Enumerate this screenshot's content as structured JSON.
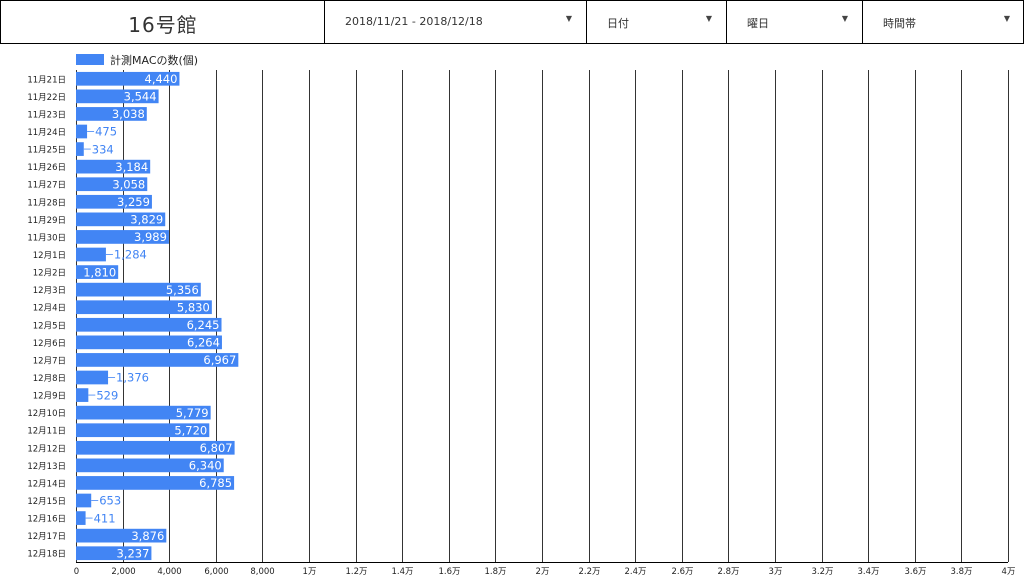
{
  "header": {
    "title": "16号館",
    "filters": [
      {
        "label": "2018/11/21 - 2018/12/18"
      },
      {
        "label": "日付"
      },
      {
        "label": "曜日"
      },
      {
        "label": "時間帯"
      }
    ]
  },
  "colors": {
    "bar": "#4285f4",
    "label_outside": "#4285f4",
    "label_inside": "#ffffff",
    "grid": "#000000"
  },
  "chart_data": {
    "type": "bar",
    "orientation": "horizontal",
    "legend": {
      "position": "top-left",
      "entries": [
        "計測MACの数(個)"
      ]
    },
    "categories": [
      "11月21日",
      "11月22日",
      "11月23日",
      "11月24日",
      "11月25日",
      "11月26日",
      "11月27日",
      "11月28日",
      "11月29日",
      "11月30日",
      "12月1日",
      "12月2日",
      "12月3日",
      "12月4日",
      "12月5日",
      "12月6日",
      "12月7日",
      "12月8日",
      "12月9日",
      "12月10日",
      "12月11日",
      "12月12日",
      "12月13日",
      "12月14日",
      "12月15日",
      "12月16日",
      "12月17日",
      "12月18日"
    ],
    "series": [
      {
        "name": "計測MACの数(個)",
        "values": [
          4440,
          3544,
          3038,
          475,
          334,
          3184,
          3058,
          3259,
          3829,
          3989,
          1284,
          1810,
          5356,
          5830,
          6245,
          6264,
          6967,
          1376,
          529,
          5779,
          5720,
          6807,
          6340,
          6785,
          653,
          411,
          3876,
          3237
        ]
      }
    ],
    "value_labels": [
      "4,440",
      "3,544",
      "3,038",
      "475",
      "334",
      "3,184",
      "3,058",
      "3,259",
      "3,829",
      "3,989",
      "1,284",
      "1,810",
      "5,356",
      "5,830",
      "6,245",
      "6,264",
      "6,967",
      "1,376",
      "529",
      "5,779",
      "5,720",
      "6,807",
      "6,340",
      "6,785",
      "653",
      "411",
      "3,876",
      "3,237"
    ],
    "xlim": [
      0,
      40000
    ],
    "xticks": [
      0,
      2000,
      4000,
      6000,
      8000,
      10000,
      12000,
      14000,
      16000,
      18000,
      20000,
      22000,
      24000,
      26000,
      28000,
      30000,
      32000,
      34000,
      36000,
      38000,
      40000
    ],
    "xtick_labels": [
      "0",
      "2,000",
      "4,000",
      "6,000",
      "8,000",
      "1万",
      "1.2万",
      "1.4万",
      "1.6万",
      "1.8万",
      "2万",
      "2.2万",
      "2.4万",
      "2.6万",
      "2.8万",
      "3万",
      "3.2万",
      "3.4万",
      "3.6万",
      "3.8万",
      "4万"
    ],
    "grid": true
  }
}
